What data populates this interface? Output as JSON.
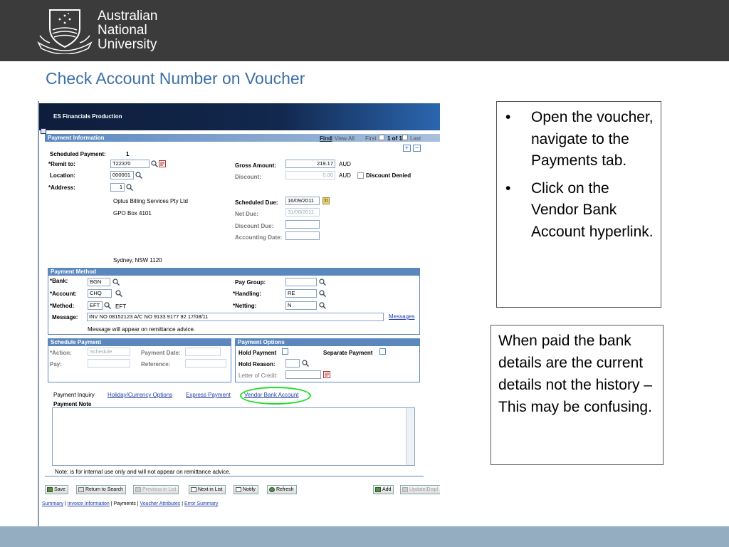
{
  "brand": {
    "line1": "Australian",
    "line2": "National",
    "line3": "University"
  },
  "slide": {
    "title": "Check Account Number on Voucher"
  },
  "ps": {
    "header": "ES Financials Production",
    "payment_info": {
      "section_title": "Payment Information",
      "find": "Find",
      "view_all": "View All",
      "first": "First",
      "count": "1 of 1",
      "last": "Last",
      "scheduled_payment_label": "Scheduled Payment:",
      "scheduled_payment_value": "1",
      "remit_to_label": "*Remit to:",
      "remit_to_value": "T22370",
      "location_label": "Location:",
      "location_value": "000001",
      "address_label": "*Address:",
      "address_value": "1",
      "addr_line1": "Optus Billing Services Pty Ltd",
      "addr_line2": "GPO Box 4101",
      "addr_line3": "Sydney, NSW  1120",
      "gross_amount_label": "Gross Amount:",
      "gross_amount_value": "219.17",
      "gross_currency": "AUD",
      "discount_label": "Discount:",
      "discount_value": "0.00",
      "discount_currency": "AUD",
      "discount_denied_label": "Discount Denied",
      "scheduled_due_label": "Scheduled Due:",
      "scheduled_due_value": "16/09/2011",
      "net_due_label": "Net Due:",
      "net_due_value": "31/08/2011",
      "discount_due_label": "Discount Due:",
      "accounting_date_label": "Accounting Date:"
    },
    "payment_method": {
      "section_title": "Payment Method",
      "bank_label": "*Bank:",
      "bank_value": "BGN",
      "account_label": "*Account:",
      "account_value": "CHQ",
      "method_label": "*Method:",
      "method_value": "EFT",
      "method_desc": "EFT",
      "message_label": "Message:",
      "message_value": "INV NO 08152123 A/C NO 9133 9177 92 17/08/11",
      "messages_link": "Messages",
      "message_note": "Message will appear on remittance advice.",
      "pay_group_label": "Pay Group:",
      "handling_label": "*Handling:",
      "handling_value": "RE",
      "netting_label": "*Netting:",
      "netting_value": "N"
    },
    "schedule_payment": {
      "section_title": "Schedule Payment",
      "action_label": "*Action:",
      "action_value": "Schedule",
      "pay_label": "Pay:",
      "payment_date_label": "Payment Date:",
      "reference_label": "Reference:"
    },
    "payment_options": {
      "section_title": "Payment Options",
      "hold_payment_label": "Hold Payment",
      "separate_payment_label": "Separate Payment",
      "hold_reason_label": "Hold Reason:",
      "letter_of_credit_label": "Letter of Credit:"
    },
    "links": {
      "payment_inquiry": "Payment Inquiry",
      "holiday_currency": "Holiday/Currency Options",
      "express_payment": "Express Payment",
      "vendor_bank_account": "Vendor Bank Account"
    },
    "payment_note_label": "Payment Note",
    "internal_note": "Note: is for internal use only and will not appear on remittance advice.",
    "toolbar": {
      "save": "Save",
      "return_to_search": "Return to Search",
      "previous_in_list": "Previous in List",
      "next_in_list": "Next in List",
      "notify": "Notify",
      "refresh": "Refresh",
      "add": "Add",
      "update_display": "Update/Displ"
    },
    "pagetabs": {
      "summary": "Summary",
      "invoice_information": "Invoice Information",
      "payments": "Payments",
      "voucher_attributes": "Voucher Attributes",
      "error_summary": "Error Summary",
      "sep": "|"
    }
  },
  "callout1": {
    "items": [
      "Open the voucher, navigate to the Payments tab.",
      "Click on the Vendor Bank Account hyperlink."
    ]
  },
  "callout2": {
    "text": "When paid the bank details are the current details not the history – This may be confusing."
  },
  "colors": {
    "topbar": "#3b3b3b",
    "title": "#3a6fa7",
    "footer": "#95adc1",
    "ps_section": "#5b87bf",
    "highlight": "#1ede25"
  }
}
